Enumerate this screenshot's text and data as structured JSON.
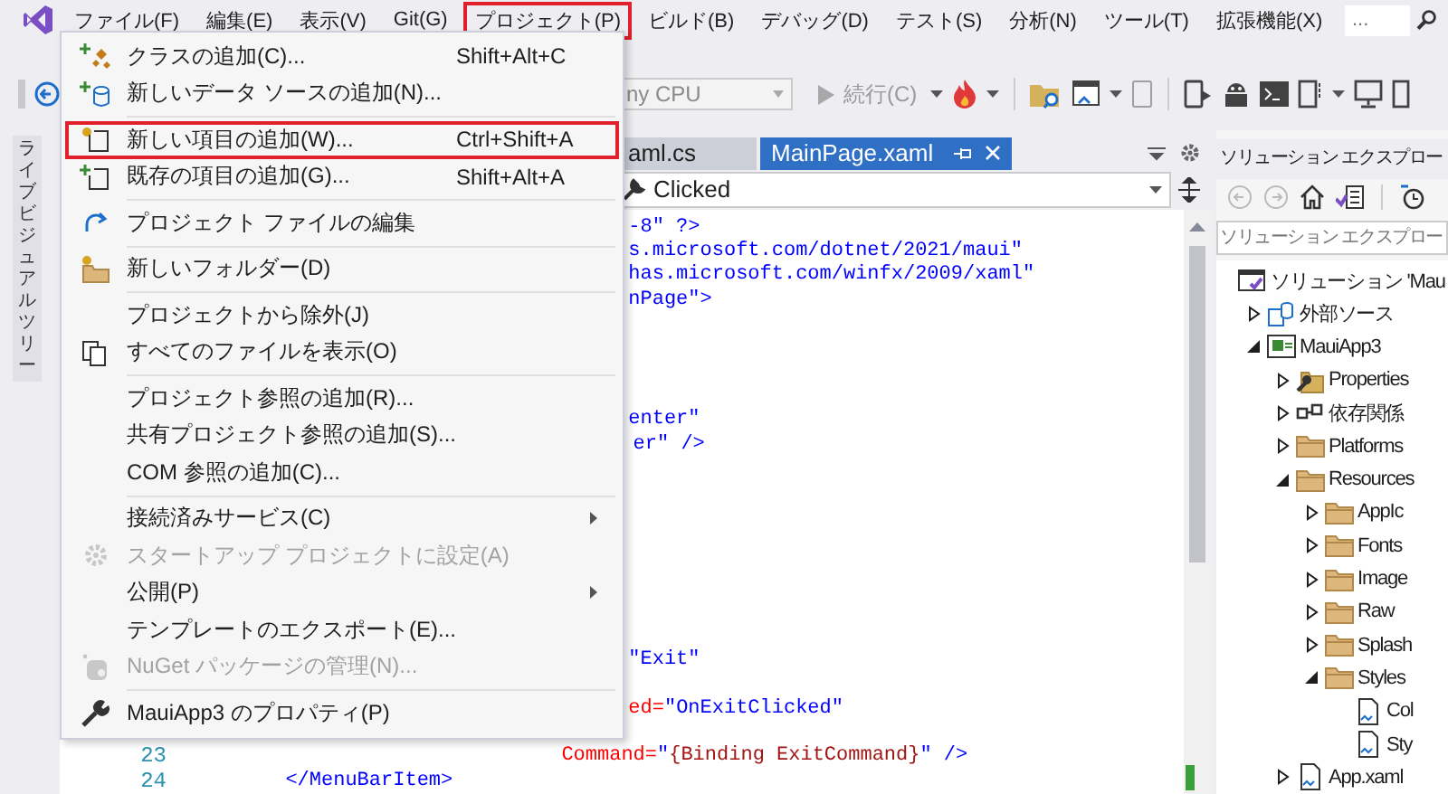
{
  "menu_bar": {
    "items": [
      {
        "label": "ファイル(F)",
        "selected": false
      },
      {
        "label": "編集(E)",
        "selected": false
      },
      {
        "label": "表示(V)",
        "selected": false
      },
      {
        "label": "Git(G)",
        "selected": false
      },
      {
        "label": "プロジェクト(P)",
        "selected": true
      },
      {
        "label": "ビルド(B)",
        "selected": false
      },
      {
        "label": "デバッグ(D)",
        "selected": false
      },
      {
        "label": "テスト(S)",
        "selected": false
      },
      {
        "label": "分析(N)",
        "selected": false
      },
      {
        "label": "ツール(T)",
        "selected": false
      },
      {
        "label": "拡張機能(X)",
        "selected": false
      }
    ],
    "search": {
      "placeholder": "..."
    }
  },
  "toolbar": {
    "platform": "ny CPU",
    "run": {
      "label": "続行(C)",
      "disabled": true
    }
  },
  "side_tab": {
    "label": "ライブビジュアルツリー"
  },
  "project_menu": [
    {
      "kind": "item",
      "label": "クラスの追加(C)...",
      "shortcut": "Shift+Alt+C",
      "selected": false,
      "disabled": false,
      "submenu": false
    },
    {
      "kind": "item",
      "label": "新しいデータ ソースの追加(N)...",
      "selected": false,
      "disabled": false,
      "submenu": false
    },
    {
      "kind": "separator"
    },
    {
      "kind": "item",
      "label": "新しい項目の追加(W)...",
      "shortcut": "Ctrl+Shift+A",
      "selected": true,
      "disabled": false,
      "submenu": false
    },
    {
      "kind": "item",
      "label": "既存の項目の追加(G)...",
      "shortcut": "Shift+Alt+A",
      "selected": false,
      "disabled": false,
      "submenu": false
    },
    {
      "kind": "separator"
    },
    {
      "kind": "item",
      "label": "プロジェクト ファイルの編集",
      "selected": false,
      "disabled": false,
      "submenu": false
    },
    {
      "kind": "separator"
    },
    {
      "kind": "item",
      "label": "新しいフォルダー(D)",
      "selected": false,
      "disabled": false,
      "submenu": false
    },
    {
      "kind": "separator"
    },
    {
      "kind": "item",
      "label": "プロジェクトから除外(J)",
      "selected": false,
      "disabled": false,
      "submenu": false
    },
    {
      "kind": "item",
      "label": "すべてのファイルを表示(O)",
      "selected": false,
      "disabled": false,
      "submenu": false
    },
    {
      "kind": "separator"
    },
    {
      "kind": "item",
      "label": "プロジェクト参照の追加(R)...",
      "selected": false,
      "disabled": false,
      "submenu": false
    },
    {
      "kind": "item",
      "label": "共有プロジェクト参照の追加(S)...",
      "selected": false,
      "disabled": false,
      "submenu": false
    },
    {
      "kind": "item",
      "label": "COM 参照の追加(C)...",
      "selected": false,
      "disabled": false,
      "submenu": false
    },
    {
      "kind": "separator"
    },
    {
      "kind": "item",
      "label": "接続済みサービス(C)",
      "selected": false,
      "disabled": false,
      "submenu": true
    },
    {
      "kind": "item",
      "label": "スタートアップ プロジェクトに設定(A)",
      "selected": false,
      "disabled": true,
      "submenu": false
    },
    {
      "kind": "item",
      "label": "公開(P)",
      "selected": false,
      "disabled": false,
      "submenu": true
    },
    {
      "kind": "item",
      "label": "テンプレートのエクスポート(E)...",
      "selected": false,
      "disabled": false,
      "submenu": false
    },
    {
      "kind": "item",
      "label": "NuGet パッケージの管理(N)...",
      "selected": false,
      "disabled": true,
      "submenu": false
    },
    {
      "kind": "separator"
    },
    {
      "kind": "item",
      "label": "MauiApp3 のプロパティ(P)",
      "selected": false,
      "disabled": false,
      "submenu": false
    }
  ],
  "editor": {
    "tabs": [
      {
        "label": "aml.cs",
        "selected": false
      },
      {
        "label": "MainPage.xaml",
        "selected": true
      }
    ],
    "member_dropdown": "Clicked",
    "code_lines": [
      {
        "segments": [
          {
            "kind": "value",
            "text": "-8\" ?>"
          }
        ]
      },
      {
        "segments": [
          {
            "kind": "value",
            "text": "s.microsoft.com/dotnet/2021/maui\""
          }
        ]
      },
      {
        "segments": [
          {
            "kind": "value",
            "text": "has.microsoft.com/winfx/2009/xaml\""
          }
        ]
      },
      {
        "segments": [
          {
            "kind": "value",
            "text": "nPage\">"
          }
        ]
      },
      {
        "segments": [
          {
            "kind": "value",
            "text": "enter\""
          }
        ]
      },
      {
        "segments": [
          {
            "kind": "value",
            "text": "er\" />"
          }
        ]
      },
      {
        "segments": [
          {
            "kind": "value",
            "text": "\"Exit\""
          }
        ]
      },
      {
        "segments": [
          {
            "kind": "attr",
            "text": "ed="
          },
          {
            "kind": "value",
            "text": "\"OnExitClicked\""
          }
        ]
      },
      {
        "number": "23",
        "segments": [
          {
            "kind": "attr",
            "text": "Command="
          },
          {
            "kind": "value",
            "text": "\""
          },
          {
            "kind": "markup",
            "text": "{Binding ExitCommand}"
          },
          {
            "kind": "value",
            "text": "\" />"
          }
        ]
      },
      {
        "number": "24",
        "segments": [
          {
            "kind": "value",
            "text": "</MenuBarItem>"
          }
        ]
      }
    ]
  },
  "solution_explorer": {
    "title": "ソリューション エクスプロー",
    "search": {
      "placeholder": "ソリューション エクスプロー"
    },
    "tree": [
      {
        "kind": "solution",
        "label": "ソリューション 'Mau",
        "children": [
          {
            "kind": "external",
            "label": "外部ソース",
            "expanded": false
          },
          {
            "kind": "project",
            "label": "MauiApp3",
            "expanded": true,
            "children": [
              {
                "kind": "properties",
                "label": "Properties",
                "expanded": false
              },
              {
                "kind": "dependencies",
                "label": "依存関係",
                "expanded": false
              },
              {
                "kind": "folder",
                "label": "Platforms",
                "expanded": false
              },
              {
                "kind": "folder",
                "label": "Resources",
                "expanded": true,
                "children": [
                  {
                    "kind": "folder",
                    "label": "AppIc",
                    "expanded": false
                  },
                  {
                    "kind": "folder",
                    "label": "Fonts",
                    "expanded": false
                  },
                  {
                    "kind": "folder",
                    "label": "Image",
                    "expanded": false
                  },
                  {
                    "kind": "folder",
                    "label": "Raw",
                    "expanded": false
                  },
                  {
                    "kind": "folder",
                    "label": "Splash",
                    "expanded": false
                  },
                  {
                    "kind": "folder",
                    "label": "Styles",
                    "expanded": true,
                    "children": [
                      {
                        "kind": "file",
                        "label": "Col"
                      },
                      {
                        "kind": "file",
                        "label": "Sty"
                      }
                    ]
                  }
                ]
              },
              {
                "kind": "file",
                "label": "App.xaml",
                "expanded": false
              }
            ]
          }
        ]
      }
    ]
  }
}
